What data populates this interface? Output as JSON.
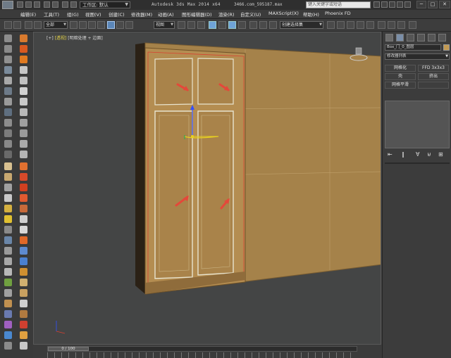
{
  "window": {
    "title": "Autodesk 3ds Max  2014 x64",
    "file": "3466.com_595187.max",
    "workspace_label": "工作区: 默认",
    "search_placeholder": "键入关键字或短语",
    "min": "─",
    "max": "□",
    "close": "✕"
  },
  "menu": [
    {
      "label": "编辑(E)"
    },
    {
      "label": "工具(T)"
    },
    {
      "label": "组(G)"
    },
    {
      "label": "视图(V)"
    },
    {
      "label": "创建(C)"
    },
    {
      "label": "修改器(M)"
    },
    {
      "label": "动画(A)"
    },
    {
      "label": "图形编辑器(D)"
    },
    {
      "label": "渲染(R)"
    },
    {
      "label": "自定义(U)"
    },
    {
      "label": "MAXScript(X)"
    },
    {
      "label": "帮助(H)"
    },
    {
      "label": "Phoenix FD"
    }
  ],
  "toolbar": {
    "filter_value": "全部",
    "coord_value": "视图",
    "selection_set_placeholder": "创建选择集"
  },
  "viewport": {
    "label_bracket": "[+]",
    "label_view": "[透视]",
    "label_shading": "[明暗处理 + 边面]"
  },
  "timeline": {
    "frame_label": "0 / 100"
  },
  "command_panel": {
    "object_name": "Box_门_0_图层",
    "modifier_list_label": "修改器列表",
    "buttons": [
      {
        "label": "网格化"
      },
      {
        "label": "FFD 3x3x3"
      },
      {
        "label": "壳"
      },
      {
        "label": "挤出"
      },
      {
        "label": "网格平滑"
      },
      {
        "label": ""
      }
    ]
  },
  "colors": {
    "cabinet": "#b08a4e",
    "selection_outline": "#e8e8d8",
    "arrow": "#e4483a",
    "gizmo_z": "#3350ff",
    "gizmo_ring": "#e8d020"
  }
}
